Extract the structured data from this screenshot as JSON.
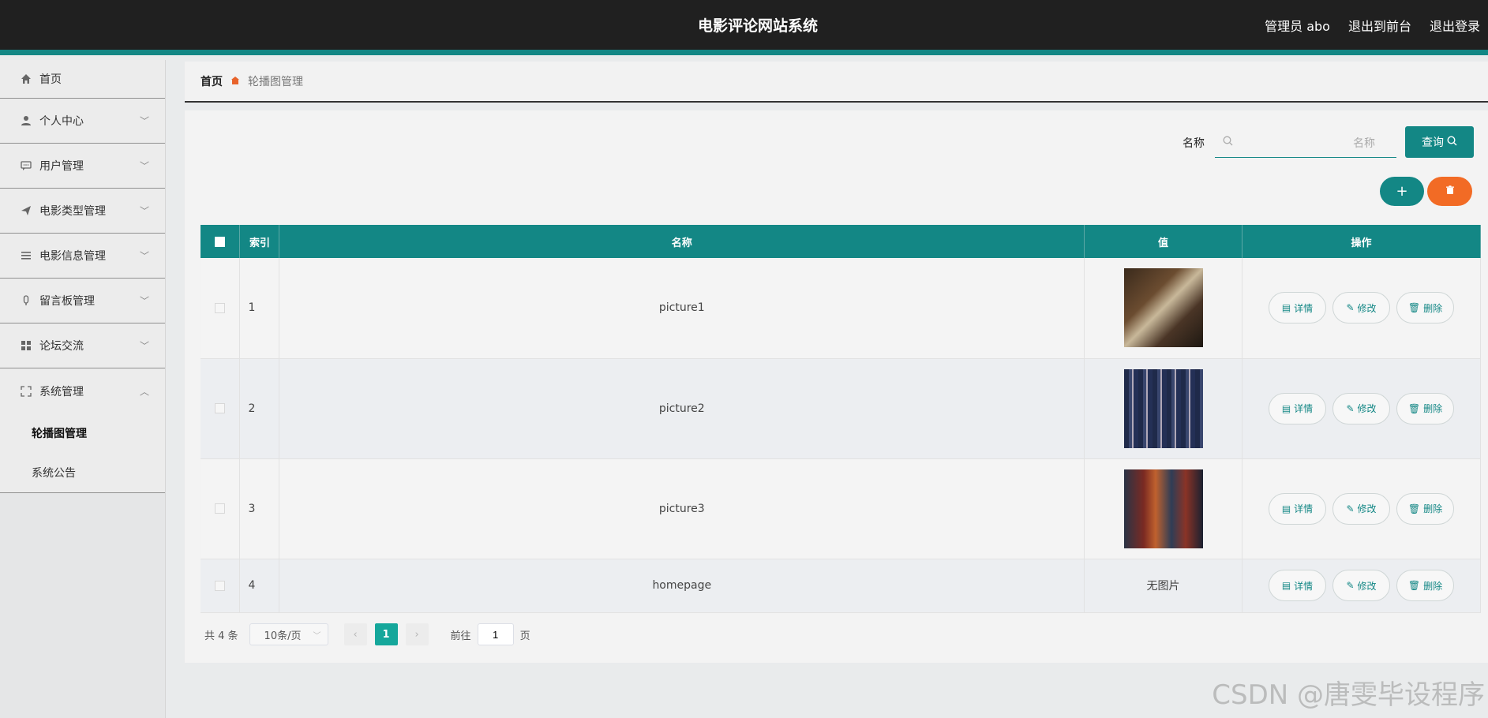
{
  "header": {
    "title": "电影评论网站系统",
    "admin_label": "管理员 abo",
    "back_front": "退出到前台",
    "logout": "退出登录"
  },
  "sidebar": {
    "items": [
      {
        "label": "首页",
        "icon": "home-icon"
      },
      {
        "label": "个人中心",
        "icon": "user-icon"
      },
      {
        "label": "用户管理",
        "icon": "chat-icon"
      },
      {
        "label": "电影类型管理",
        "icon": "send-icon"
      },
      {
        "label": "电影信息管理",
        "icon": "list-icon"
      },
      {
        "label": "留言板管理",
        "icon": "mic-icon"
      },
      {
        "label": "论坛交流",
        "icon": "grid-icon"
      },
      {
        "label": "系统管理",
        "icon": "fullscreen-icon"
      }
    ],
    "sub_items": [
      "轮播图管理",
      "系统公告"
    ]
  },
  "breadcrumb": {
    "home": "首页",
    "current": "轮播图管理"
  },
  "search": {
    "label": "名称",
    "placeholder": "名称",
    "button": "查询"
  },
  "table": {
    "headers": {
      "index": "索引",
      "name": "名称",
      "value": "值",
      "ops": "操作"
    },
    "rows": [
      {
        "index": "1",
        "name": "picture1",
        "value": ""
      },
      {
        "index": "2",
        "name": "picture2",
        "value": ""
      },
      {
        "index": "3",
        "name": "picture3",
        "value": ""
      },
      {
        "index": "4",
        "name": "homepage",
        "value": "无图片"
      }
    ],
    "op_labels": {
      "detail": "详情",
      "edit": "修改",
      "delete": "删除"
    }
  },
  "pagination": {
    "total": "共 4 条",
    "page_size": "10条/页",
    "current_page": "1",
    "goto_prefix": "前往",
    "goto_value": "1",
    "goto_suffix": "页"
  },
  "watermark": "CSDN @唐雯毕设程序",
  "colors": {
    "primary": "#138785",
    "danger": "#f26b25",
    "header_bg": "#202020"
  }
}
